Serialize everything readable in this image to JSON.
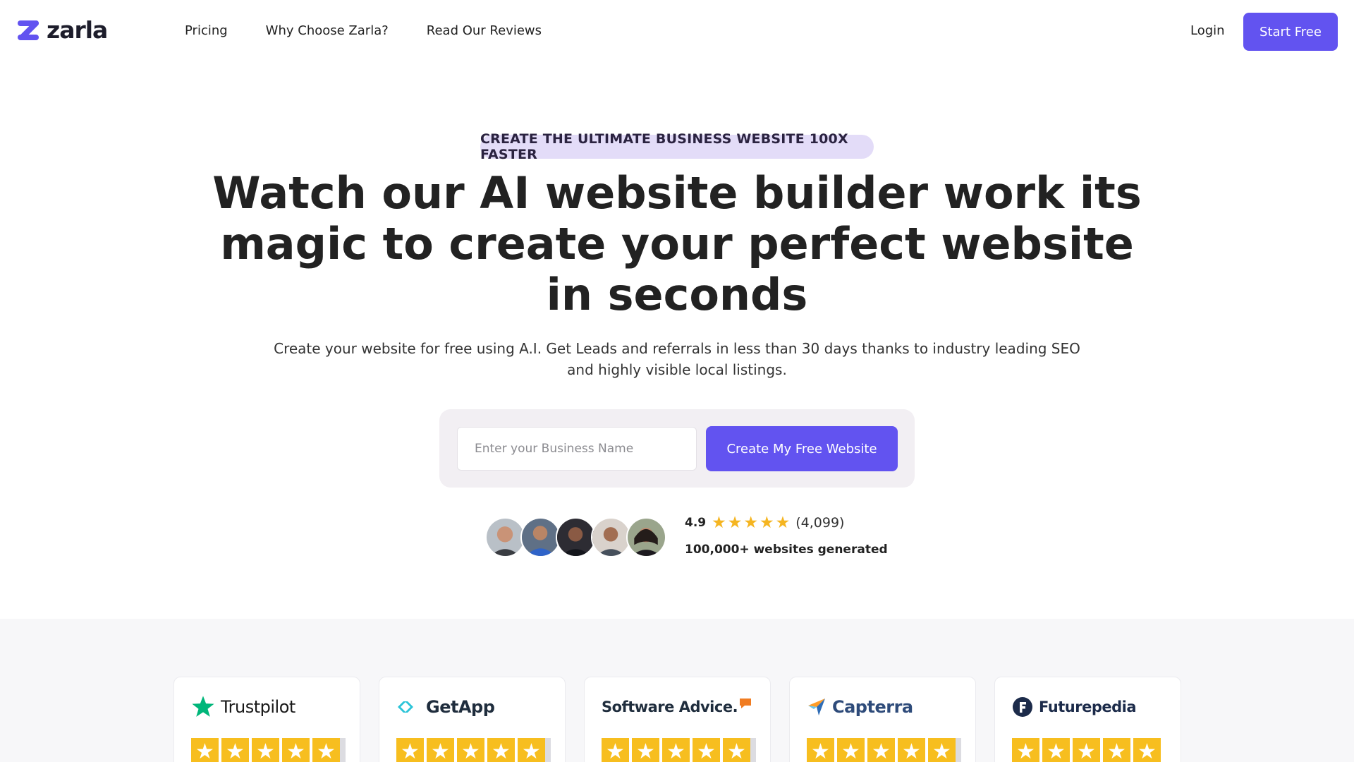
{
  "header": {
    "brand": "zarla",
    "nav": [
      {
        "label": "Pricing"
      },
      {
        "label": "Why Choose Zarla?"
      },
      {
        "label": "Read Our Reviews"
      }
    ],
    "login_label": "Login",
    "start_label": "Start Free"
  },
  "hero": {
    "badge": "CREATE THE ULTIMATE BUSINESS WEBSITE 100X FASTER",
    "headline": "Watch our AI website builder work its magic to create your perfect website in seconds",
    "subtext": "Create your website for free using A.I. Get Leads and referrals in less than 30 days thanks to industry leading SEO and highly visible local listings.",
    "input_placeholder": "Enter your Business Name",
    "input_value": "",
    "cta_label": "Create My Free Website"
  },
  "social_proof": {
    "score": "4.9",
    "stars": 5,
    "count": "(4,099)",
    "sites_generated": "100,000+ websites generated"
  },
  "review_sites": [
    {
      "name": "Trustpilot",
      "icon": "trustpilot-star-icon",
      "stars": 5
    },
    {
      "name": "GetApp",
      "icon": "getapp-chevrons-icon",
      "stars": 5
    },
    {
      "name": "Software Advice.",
      "icon": "software-advice-bubble-icon",
      "stars": 5
    },
    {
      "name": "Capterra",
      "icon": "capterra-arrow-icon",
      "stars": 5
    },
    {
      "name": "Futurepedia",
      "icon": "futurepedia-f-icon",
      "stars": 5
    }
  ],
  "colors": {
    "accent": "#6253f0",
    "badge_bg": "#e3dcf8",
    "star_yellow": "#f7be1f",
    "trustpilot_green": "#00b67a",
    "getapp_teal": "#2bc4d8",
    "software_advice_orange": "#f07c22",
    "capterra_blue": "#2e6cb5",
    "futurepedia_navy": "#1c2b4a"
  }
}
